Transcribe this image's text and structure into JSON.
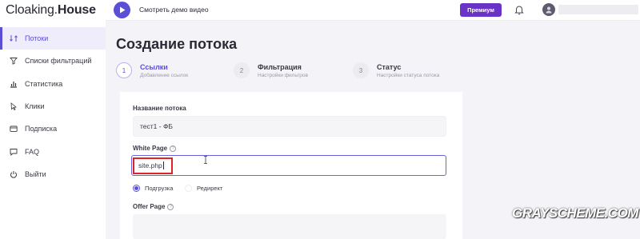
{
  "app": {
    "logo_part1": "Cloaking.",
    "logo_part2": "House"
  },
  "sidebar": {
    "items": [
      {
        "label": "Потоки",
        "icon": "swap-icon",
        "active": true
      },
      {
        "label": "Списки фильтраций",
        "icon": "filter-icon",
        "active": false
      },
      {
        "label": "Статистика",
        "icon": "bar-chart-icon",
        "active": false
      },
      {
        "label": "Клики",
        "icon": "pointer-icon",
        "active": false
      },
      {
        "label": "Подписка",
        "icon": "card-icon",
        "active": false
      },
      {
        "label": "FAQ",
        "icon": "chat-icon",
        "active": false
      },
      {
        "label": "Выйти",
        "icon": "power-icon",
        "active": false
      }
    ]
  },
  "topbar": {
    "demo_label": "Смотреть демо видео",
    "premium_label": "Премиум"
  },
  "page": {
    "title": "Создание потока"
  },
  "steps": [
    {
      "number": "1",
      "title": "Ссылки",
      "subtitle": "Добавление ссылок",
      "active": true
    },
    {
      "number": "2",
      "title": "Фильтрация",
      "subtitle": "Настройки фильтров",
      "active": false
    },
    {
      "number": "3",
      "title": "Статус",
      "subtitle": "Настройки статуса потока",
      "active": false
    }
  ],
  "form": {
    "stream_name_label": "Название потока",
    "stream_name_value": "тест1 - ФБ",
    "white_page_label": "White Page",
    "white_page_value": "site.php",
    "radio_load_label": "Подгрузка",
    "radio_redirect_label": "Редирект",
    "offer_page_label": "Offer Page",
    "help_glyph": "?"
  },
  "watermark": "GRAYSCHEME.COM",
  "colors": {
    "accent": "#5b4fd6",
    "premium": "#6a33c7",
    "highlight_box": "#e02424"
  }
}
